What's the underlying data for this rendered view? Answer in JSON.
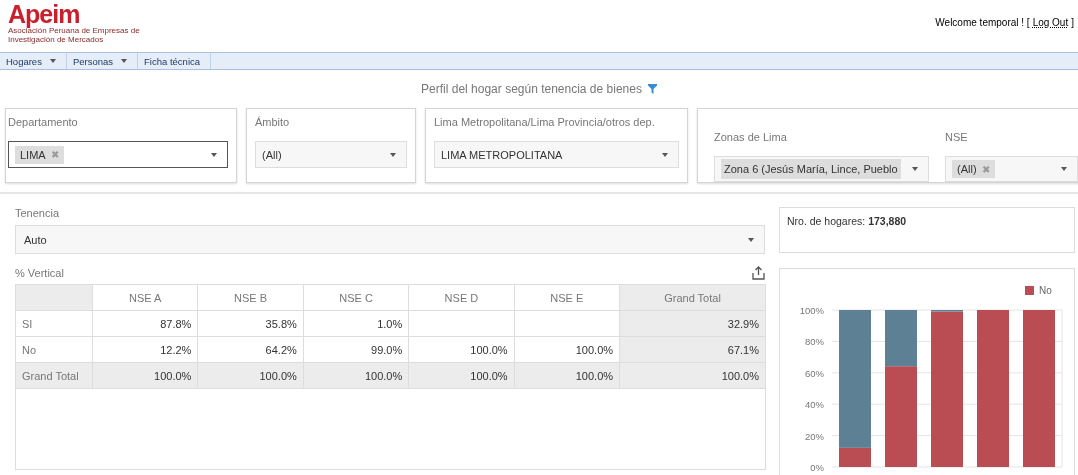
{
  "header": {
    "logo": "Apeim",
    "logo_subtitle": "Asociación Peruana de Empresas de Investigación de Mercados",
    "welcome": "Welcome temporal ! [",
    "logout": "Log Out",
    "welcome_end": "]"
  },
  "menu": [
    {
      "label": "Hogares",
      "has_dropdown": true
    },
    {
      "label": "Personas",
      "has_dropdown": true
    },
    {
      "label": "Ficha técnica",
      "has_dropdown": false
    }
  ],
  "title": "Perfil del hogar según tenencia de bienes",
  "filter_panels": [
    {
      "filters": [
        {
          "label": "Departamento",
          "kind": "multi",
          "value": "LIMA",
          "remove_glyph": "✖",
          "focused": true
        }
      ]
    },
    {
      "filters": [
        {
          "label": "Ámbito",
          "kind": "single",
          "value": "(All)",
          "focused": false
        }
      ]
    },
    {
      "filters": [
        {
          "label": "Lima Metropolitana/Lima Provincia/otros dep.",
          "kind": "single",
          "value": "LIMA METROPOLITANA",
          "focused": false
        }
      ]
    },
    {
      "filters": [
        {
          "label": "Zonas de Lima",
          "kind": "tag",
          "value": "Zona 6 (Jesús María, Lince, Pueblo",
          "focused": false
        },
        {
          "label": "NSE",
          "kind": "multi",
          "value": "(All)",
          "remove_glyph": "✖",
          "focused": false
        }
      ]
    }
  ],
  "tenencia": {
    "label": "Tenencia",
    "value": "Auto"
  },
  "pivot": {
    "title": "% Vertical",
    "columns": [
      "NSE A",
      "NSE B",
      "NSE C",
      "NSE D",
      "NSE E",
      "Grand Total"
    ],
    "rows": [
      {
        "label": "SI",
        "total": false,
        "cells": [
          "87.8%",
          "35.8%",
          "1.0%",
          "",
          "",
          "32.9%"
        ]
      },
      {
        "label": "No",
        "total": false,
        "cells": [
          "12.2%",
          "64.2%",
          "99.0%",
          "100.0%",
          "100.0%",
          "67.1%"
        ]
      },
      {
        "label": "Grand Total",
        "total": true,
        "cells": [
          "100.0%",
          "100.0%",
          "100.0%",
          "100.0%",
          "100.0%",
          "100.0%"
        ]
      }
    ]
  },
  "summary": {
    "label": "Nro. de hogares:",
    "value": "173,880"
  },
  "chart": {
    "chart_data": {
      "type": "bar",
      "stacked": true,
      "orientation": "vertical",
      "grid": true,
      "ylim": [
        0,
        100
      ],
      "yticks": [
        {
          "value": 0,
          "label": "0%"
        },
        {
          "value": 20,
          "label": "20%"
        },
        {
          "value": 40,
          "label": "40%"
        },
        {
          "value": 60,
          "label": "60%"
        },
        {
          "value": 80,
          "label": "80%"
        },
        {
          "value": 100,
          "label": "100%"
        }
      ],
      "series": [
        {
          "name": "No",
          "color": "#b94d53",
          "values": [
            12.2,
            64.2,
            99.0,
            100.0,
            100.0
          ]
        },
        {
          "color": "#5e8095",
          "values": [
            87.8,
            35.8,
            1.0,
            null,
            null
          ]
        }
      ]
    }
  }
}
